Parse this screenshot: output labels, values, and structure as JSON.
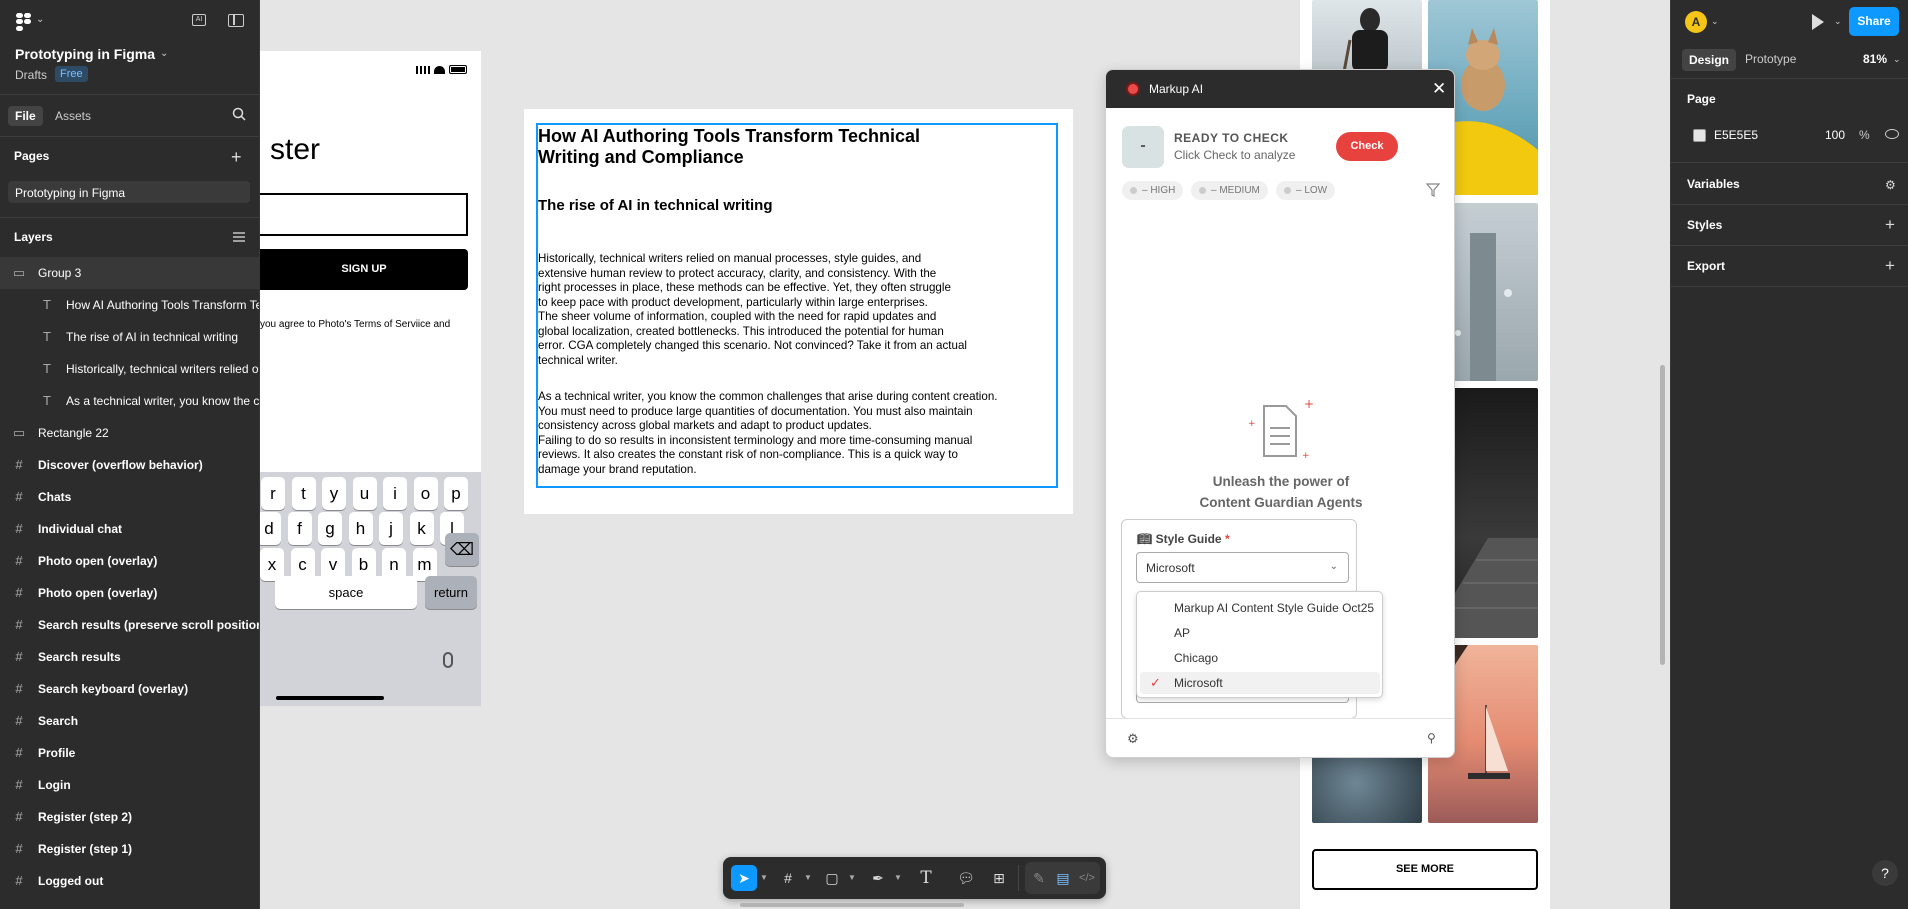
{
  "left_panel": {
    "project_name": "Prototyping in Figma",
    "drafts": "Drafts",
    "plan_badge": "Free",
    "tabs": [
      "File",
      "Assets"
    ],
    "pages_heading": "Pages",
    "pages": [
      "Prototyping in Figma"
    ],
    "layers_heading": "Layers",
    "layers": [
      {
        "label": "Group 3",
        "kind": "group"
      },
      {
        "label": "How AI Authoring Tools Transform Te",
        "kind": "text"
      },
      {
        "label": "The rise of AI in technical writing",
        "kind": "text"
      },
      {
        "label": "Historically, technical writers relied o",
        "kind": "text"
      },
      {
        "label": "As a technical writer, you know the co",
        "kind": "text"
      },
      {
        "label": "Rectangle 22",
        "kind": "rect"
      },
      {
        "label": "Discover (overflow behavior)",
        "kind": "frame"
      },
      {
        "label": "Chats",
        "kind": "frame"
      },
      {
        "label": "Individual chat",
        "kind": "frame"
      },
      {
        "label": "Photo open (overlay)",
        "kind": "frame"
      },
      {
        "label": "Photo open (overlay)",
        "kind": "frame"
      },
      {
        "label": "Search results (preserve scroll position)",
        "kind": "frame"
      },
      {
        "label": "Search results",
        "kind": "frame"
      },
      {
        "label": "Search keyboard (overlay)",
        "kind": "frame"
      },
      {
        "label": "Search",
        "kind": "frame"
      },
      {
        "label": "Profile",
        "kind": "frame"
      },
      {
        "label": "Login",
        "kind": "frame"
      },
      {
        "label": "Register (step 2)",
        "kind": "frame"
      },
      {
        "label": "Register (step 1)",
        "kind": "frame"
      },
      {
        "label": "Logged out",
        "kind": "frame"
      }
    ]
  },
  "phone": {
    "title": "ster",
    "signup_label": "SIGN UP",
    "terms": "you agree to Photo's Terms of Serviice and",
    "keys_row1": [
      "r",
      "t",
      "y",
      "u",
      "i",
      "o",
      "p"
    ],
    "keys_row2": [
      "d",
      "f",
      "g",
      "h",
      "j",
      "k",
      "l"
    ],
    "keys_row3": [
      "x",
      "c",
      "v",
      "b",
      "n",
      "m"
    ],
    "space_label": "space",
    "return_label": "return"
  },
  "article": {
    "title": "How AI Authoring Tools Transform Technical Writing and Compliance",
    "subtitle": "The rise of AI in technical writing",
    "para1": "Historically, technical writers relied on manual processes, style guides, and\nextensive human review to protect accuracy, clarity, and consistency. With the\nright processes in place, these methods can be effective. Yet, they often struggle\nto keep pace with product development, particularly within large enterprises.\nThe sheer volume of information, coupled with the need for rapid updates and\nglobal localization, created bottlenecks. This introduced the potential for human\nerror. CGA completely changed this scenario. Not convinced? Take it from an actual\ntechnical writer.",
    "para2": "As a technical writer, you know the common challenges that arise during content creation.\nYou must need to produce large quantities of documentation. You must also maintain\nconsistency across global markets and adapt to product updates.\nFailing to do so results in inconsistent terminology and more time-consuming manual\nreviews. It also creates the constant risk of non-compliance. This is a quick way to\ndamage your brand reputation."
  },
  "markup_ai": {
    "title": "Markup AI",
    "status_icon": "-",
    "status": "READY TO CHECK",
    "hint": "Click Check to analyze",
    "check_label": "Check",
    "pills": [
      "– HIGH",
      "– MEDIUM",
      "– LOW"
    ],
    "headline_1": "Unleash the power of",
    "headline_2": "Content Guardian Agents",
    "style_guide_label": "Style Guide",
    "required_mark": "*",
    "selected": "Microsoft",
    "options": [
      "Markup AI Content Style Guide Oct25",
      "AP",
      "Chicago",
      "Microsoft"
    ],
    "selected_index": 3
  },
  "photos": {
    "see_more": "SEE MORE"
  },
  "right_panel": {
    "avatar_initial": "A",
    "share_label": "Share",
    "tabs": [
      "Design",
      "Prototype"
    ],
    "zoom": "81%",
    "page_heading": "Page",
    "bg_hex": "E5E5E5",
    "bg_opacity": "100",
    "pct_sign": "%",
    "sections": [
      "Variables",
      "Styles",
      "Export"
    ],
    "help": "?"
  },
  "colors": {
    "panel": "#2c2c2c",
    "canvas": "#e5e5e5",
    "accent": "#0d99ff",
    "markup_red": "#e8423f"
  }
}
